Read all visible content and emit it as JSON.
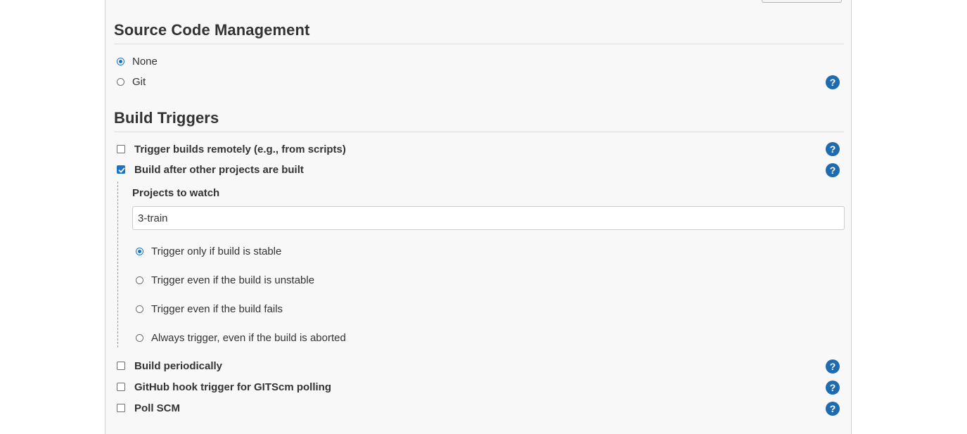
{
  "scm": {
    "title": "Source Code Management",
    "options": [
      {
        "label": "None",
        "selected": true
      },
      {
        "label": "Git",
        "selected": false
      }
    ]
  },
  "triggers": {
    "title": "Build Triggers",
    "remote": {
      "label": "Trigger builds remotely (e.g., from scripts)",
      "checked": false
    },
    "after_other": {
      "label": "Build after other projects are built",
      "checked": true,
      "projects_label": "Projects to watch",
      "projects_value": "3-train",
      "options": [
        {
          "label": "Trigger only if build is stable",
          "selected": true
        },
        {
          "label": "Trigger even if the build is unstable",
          "selected": false
        },
        {
          "label": "Trigger even if the build fails",
          "selected": false
        },
        {
          "label": "Always trigger, even if the build is aborted",
          "selected": false
        }
      ]
    },
    "periodic": {
      "label": "Build periodically",
      "checked": false
    },
    "github_hook": {
      "label": "GitHub hook trigger for GITScm polling",
      "checked": false
    },
    "poll_scm": {
      "label": "Poll SCM",
      "checked": false
    }
  },
  "help": {
    "glyph": "?",
    "icon": "help-icon"
  },
  "colors": {
    "accent": "#1a73c6",
    "help": "#1f6bb0"
  }
}
